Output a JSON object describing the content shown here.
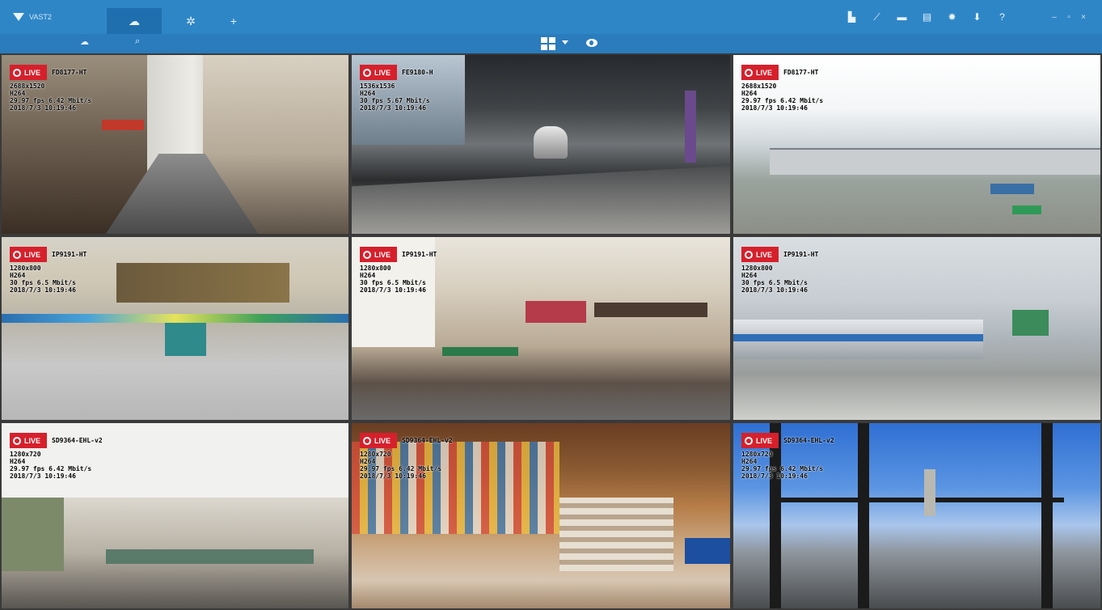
{
  "app": {
    "logo_text": "VAST2",
    "tabs": [
      {
        "icon": "live-view-icon",
        "glyph": "☁"
      },
      {
        "icon": "settings-icon",
        "glyph": "✲"
      },
      {
        "icon": "add-tab-icon",
        "glyph": "+"
      }
    ],
    "toolbar_icons": [
      {
        "name": "building-icon",
        "glyph": "▙"
      },
      {
        "name": "chart-icon",
        "glyph": "⟋"
      },
      {
        "name": "video-wall-icon",
        "glyph": "▬"
      },
      {
        "name": "document-icon",
        "glyph": "▤"
      },
      {
        "name": "gear-icon",
        "glyph": "✹"
      },
      {
        "name": "download-icon",
        "glyph": "⬇"
      },
      {
        "name": "help-icon",
        "glyph": "?"
      }
    ],
    "window_controls": [
      {
        "name": "minimize-icon",
        "glyph": "–"
      },
      {
        "name": "maximize-icon",
        "glyph": "▫"
      },
      {
        "name": "close-icon",
        "glyph": "×"
      }
    ],
    "sub_icons": [
      {
        "name": "cloud-icon",
        "glyph": "☁"
      },
      {
        "name": "search-icon",
        "glyph": "⌕"
      }
    ]
  },
  "live_badge": "LIVE",
  "cameras": [
    {
      "name": "FD8177-HT",
      "res": "2688x1520",
      "codec": "H264",
      "rate": "29.97 fps 6.42 Mbit/s",
      "time": "2018/7/3 10:19:46"
    },
    {
      "name": "FE9180-H",
      "res": "1536x1536",
      "codec": "H264",
      "rate": "30 fps 5.67 Mbit/s",
      "time": "2018/7/3 10:19:46"
    },
    {
      "name": "FD8177-HT",
      "res": "2688x1520",
      "codec": "H264",
      "rate": "29.97 fps 6.42 Mbit/s",
      "time": "2018/7/3 10:19:46"
    },
    {
      "name": "IP9191-HT",
      "res": "1280x800",
      "codec": "H264",
      "rate": "30 fps 6.5 Mbit/s",
      "time": "2018/7/3 10:19:46"
    },
    {
      "name": "IP9191-HT",
      "res": "1280x800",
      "codec": "H264",
      "rate": "30 fps 6.5 Mbit/s",
      "time": "2018/7/3 10:19:46"
    },
    {
      "name": "IP9191-HT",
      "res": "1280x800",
      "codec": "H264",
      "rate": "30 fps 6.5 Mbit/s",
      "time": "2018/7/3 10:19:46"
    },
    {
      "name": "SD9364-EHL-v2",
      "res": "1280x720",
      "codec": "H264",
      "rate": "29.97 fps 6.42 Mbit/s",
      "time": "2018/7/3 10:19:46"
    },
    {
      "name": "SD9364-EHL-v2",
      "res": "1280x720",
      "codec": "H264",
      "rate": "29.97 fps 6.42 Mbit/s",
      "time": "2018/7/3 10:19:46"
    },
    {
      "name": "SD9364-EHL-v2",
      "res": "1280x720",
      "codec": "H264",
      "rate": "29.97 fps 6.42 Mbit/s",
      "time": "2018/7/3 10:19:46"
    }
  ]
}
